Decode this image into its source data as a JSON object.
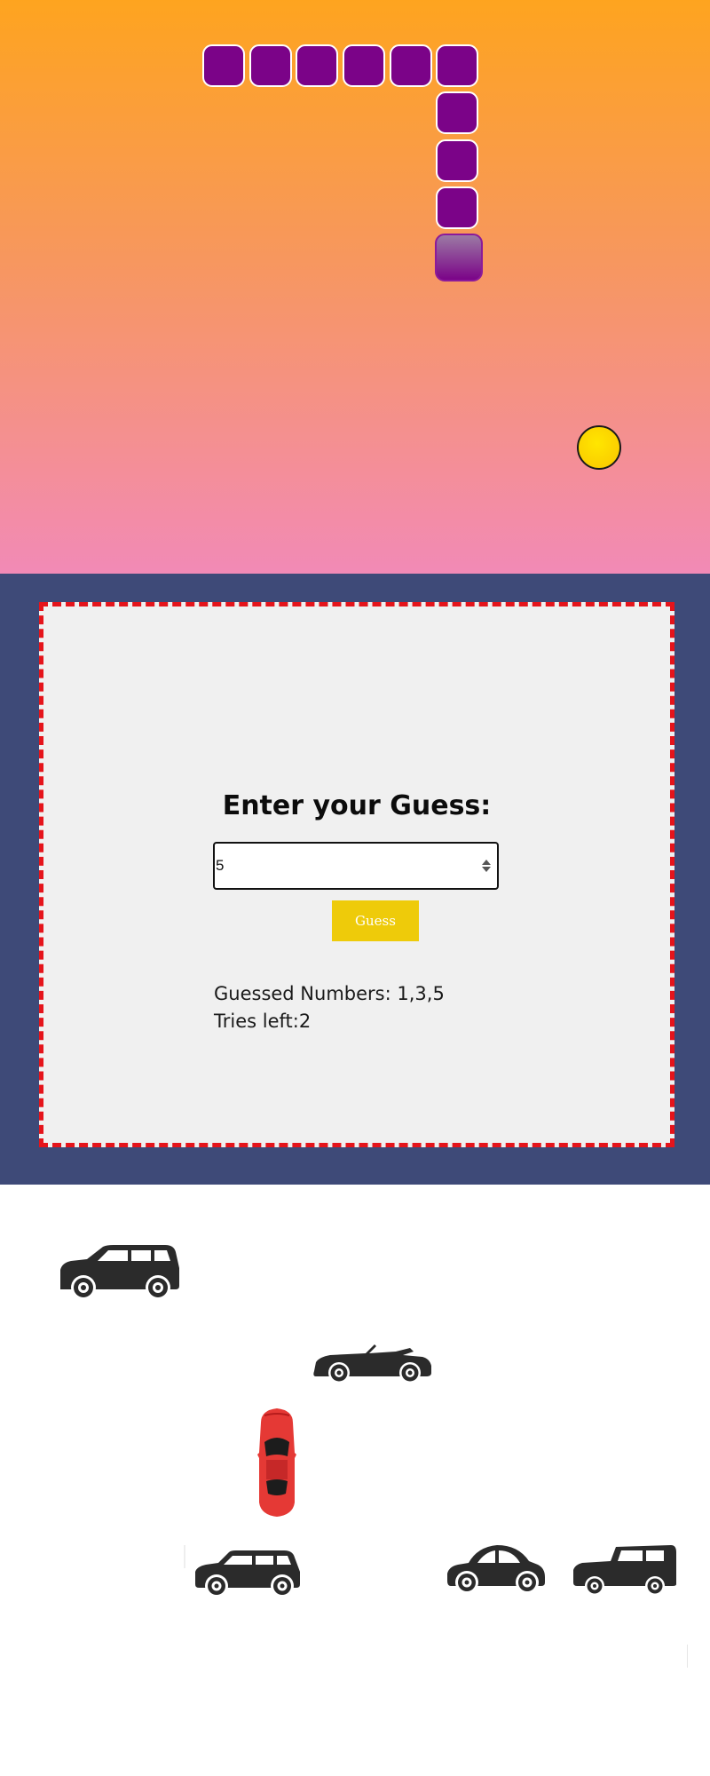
{
  "game": {
    "snake_color": "#7b0388",
    "snake_head_color": "#8b5f96",
    "food_color": "#fbcf00",
    "board_gradient": [
      "#fea41f",
      "#f7975e",
      "#f28ab6"
    ]
  },
  "guess": {
    "title": "Enter your Guess:",
    "input_value": "5",
    "button_label": "Guess",
    "guessed_label": "Guessed Numbers: ",
    "guessed_values": "1,3,5",
    "tries_label": "Tries left:",
    "tries_value": "2",
    "border_color": "#e5141b",
    "button_color": "#eecb0a",
    "section_bg": "#3e4a78"
  },
  "cars": [
    {
      "kind": "suv-icon",
      "color": "#2b2b2b"
    },
    {
      "kind": "convertible-icon",
      "color": "#2b2b2b"
    },
    {
      "kind": "sports-car-topview-icon",
      "color": "#e53935"
    },
    {
      "kind": "mini-hatchback-icon",
      "color": "#2b2b2b"
    },
    {
      "kind": "beetle-icon",
      "color": "#2b2b2b"
    },
    {
      "kind": "jeep-icon",
      "color": "#2b2b2b"
    }
  ]
}
